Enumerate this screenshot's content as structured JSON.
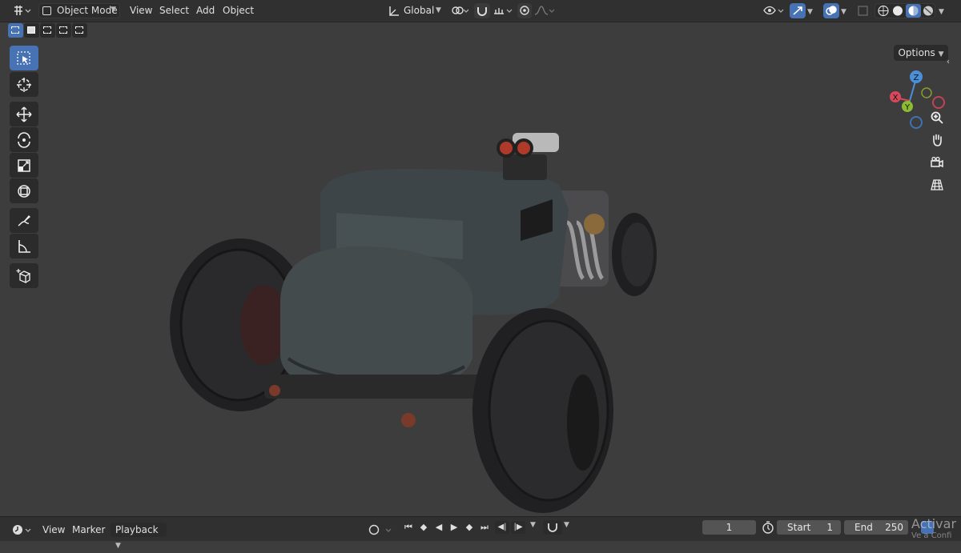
{
  "header": {
    "mode_label": "Object Mode",
    "menus": [
      "View",
      "Select",
      "Add",
      "Object"
    ],
    "orientation_label": "Global"
  },
  "viewport": {
    "options_label": "Options",
    "gizmo": {
      "x_label": "X",
      "y_label": "Y",
      "z_label": "Z"
    }
  },
  "timeline": {
    "menus": [
      "View",
      "Marker",
      "Playback"
    ],
    "current_frame": "1",
    "start_label": "Start",
    "start_value": "1",
    "end_label": "End",
    "end_value": "250"
  },
  "overlay": {
    "activate_text": "Activar",
    "activate_sub": "Ve a Confi"
  },
  "colors": {
    "accent": "#4772b3",
    "viewport_bg": "#3d3d3d",
    "header_bg": "#303030"
  }
}
